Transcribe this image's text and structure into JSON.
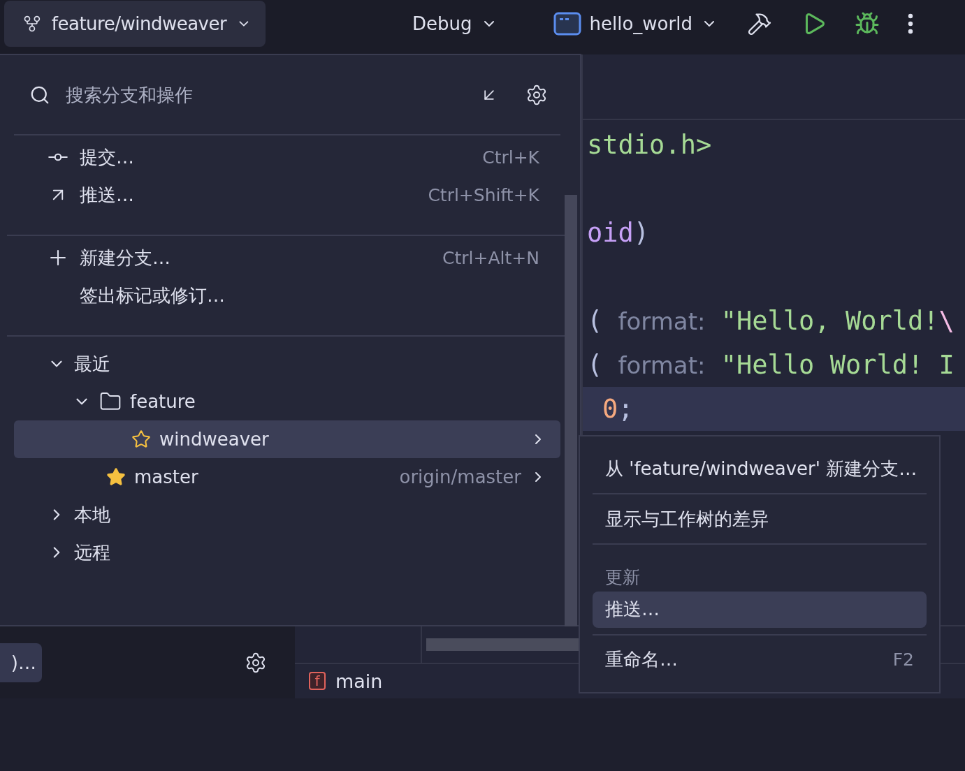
{
  "toolbar": {
    "branch": "feature/windweaver",
    "configuration": "Debug",
    "target": "hello_world"
  },
  "editor": {
    "lines": [
      {
        "current": false,
        "segments": [
          {
            "kind": "string",
            "text": "stdio.h>"
          }
        ]
      },
      {
        "current": false,
        "segments": [
          {
            "kind": "keyword",
            "text": "oid"
          },
          {
            "kind": "plain",
            "text": ")"
          }
        ]
      },
      {
        "current": false,
        "segments": [
          {
            "kind": "plain",
            "text": "( "
          },
          {
            "kind": "hint",
            "text": "format:"
          },
          {
            "kind": "string",
            "text": " \"Hello, World!"
          },
          {
            "kind": "escape",
            "text": "\\"
          }
        ]
      },
      {
        "current": false,
        "segments": [
          {
            "kind": "plain",
            "text": "( "
          },
          {
            "kind": "hint",
            "text": "format:"
          },
          {
            "kind": "string",
            "text": " \"Hello World! I"
          }
        ]
      },
      {
        "current": true,
        "segments": [
          {
            "kind": "number",
            "text": "0"
          },
          {
            "kind": "plain",
            "text": ";"
          }
        ]
      }
    ]
  },
  "bottom": {
    "left_button": ")…",
    "file_tab_icon": "f",
    "file_tab": "main"
  },
  "branch_popup": {
    "search": {
      "placeholder": "搜索分支和操作"
    },
    "action_groups": [
      [
        {
          "label": "提交…",
          "shortcut": "Ctrl+K"
        },
        {
          "label": "推送…",
          "shortcut": "Ctrl+Shift+K"
        }
      ],
      [
        {
          "label": "新建分支…",
          "shortcut": "Ctrl+Alt+N"
        },
        {
          "label": "签出标记或修订…"
        }
      ]
    ],
    "tree": [
      {
        "label": "最近",
        "expanded": true,
        "children": [
          {
            "kind": "folder",
            "label": "feature",
            "expanded": true,
            "children": [
              {
                "kind": "branch",
                "label": "windweaver",
                "starred": false,
                "selected": true
              }
            ]
          },
          {
            "kind": "branch",
            "label": "master",
            "starred": true,
            "selected": false,
            "remote": "origin/master"
          }
        ]
      },
      {
        "label": "本地",
        "expanded": false
      },
      {
        "label": "远程",
        "expanded": false
      }
    ]
  },
  "context_menu": {
    "items": [
      {
        "kind": "item",
        "label": "从 'feature/windweaver' 新建分支…",
        "selected": false
      },
      {
        "kind": "separator"
      },
      {
        "kind": "item",
        "label": "显示与工作树的差异",
        "selected": false
      },
      {
        "kind": "separator"
      },
      {
        "kind": "header",
        "label": "更新"
      },
      {
        "kind": "item",
        "label": "推送…",
        "selected": true
      },
      {
        "kind": "separator"
      },
      {
        "kind": "item",
        "label": "重命名…",
        "shortcut": "F2",
        "selected": false
      }
    ]
  }
}
